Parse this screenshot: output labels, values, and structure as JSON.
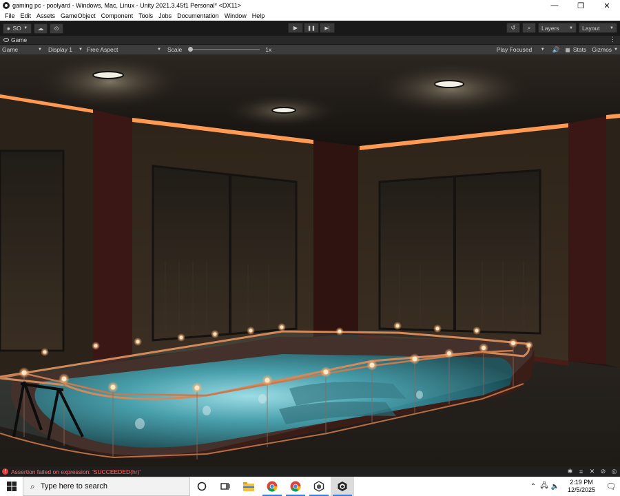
{
  "window": {
    "title": "gaming pc - poolyard - Windows, Mac, Linux - Unity 2021.3.45f1 Personal* <DX11>",
    "minimize": "—",
    "maximize": "❐",
    "close": "✕"
  },
  "menu": [
    "File",
    "Edit",
    "Assets",
    "GameObject",
    "Component",
    "Tools",
    "Jobs",
    "Documentation",
    "Window",
    "Help"
  ],
  "toolbar": {
    "account_label": "SO",
    "layers_label": "Layers",
    "layout_label": "Layout",
    "play_icon": "▶",
    "pause_icon": "❚❚",
    "step_icon": "▶|"
  },
  "game_tab": {
    "label": "Game",
    "menu_icon": "⋮"
  },
  "game_toolbar": {
    "mode": "Game",
    "display": "Display 1",
    "aspect": "Free Aspect",
    "scale_label": "Scale",
    "scale_value": "1x",
    "scale_fraction": 0.0,
    "play_mode": "Play Focused",
    "stats": "Stats",
    "gizmos": "Gizmos"
  },
  "status": {
    "message": "Assertion failed on expression: 'SUCCEEDED(hr)'",
    "error_color": "#e53c3c"
  },
  "taskbar": {
    "search_placeholder": "Type here to search",
    "time": "2:19 PM",
    "date": "12/5/2025",
    "apps": [
      "cortana-icon",
      "task-view-icon",
      "file-explorer-icon",
      "chrome-icon",
      "chrome-icon",
      "unity-hub-icon",
      "unity-editor-icon"
    ]
  },
  "colors": {
    "editor_bg": "#282828",
    "toolbar_bg": "#191919",
    "accent_light": "#ffb070"
  }
}
